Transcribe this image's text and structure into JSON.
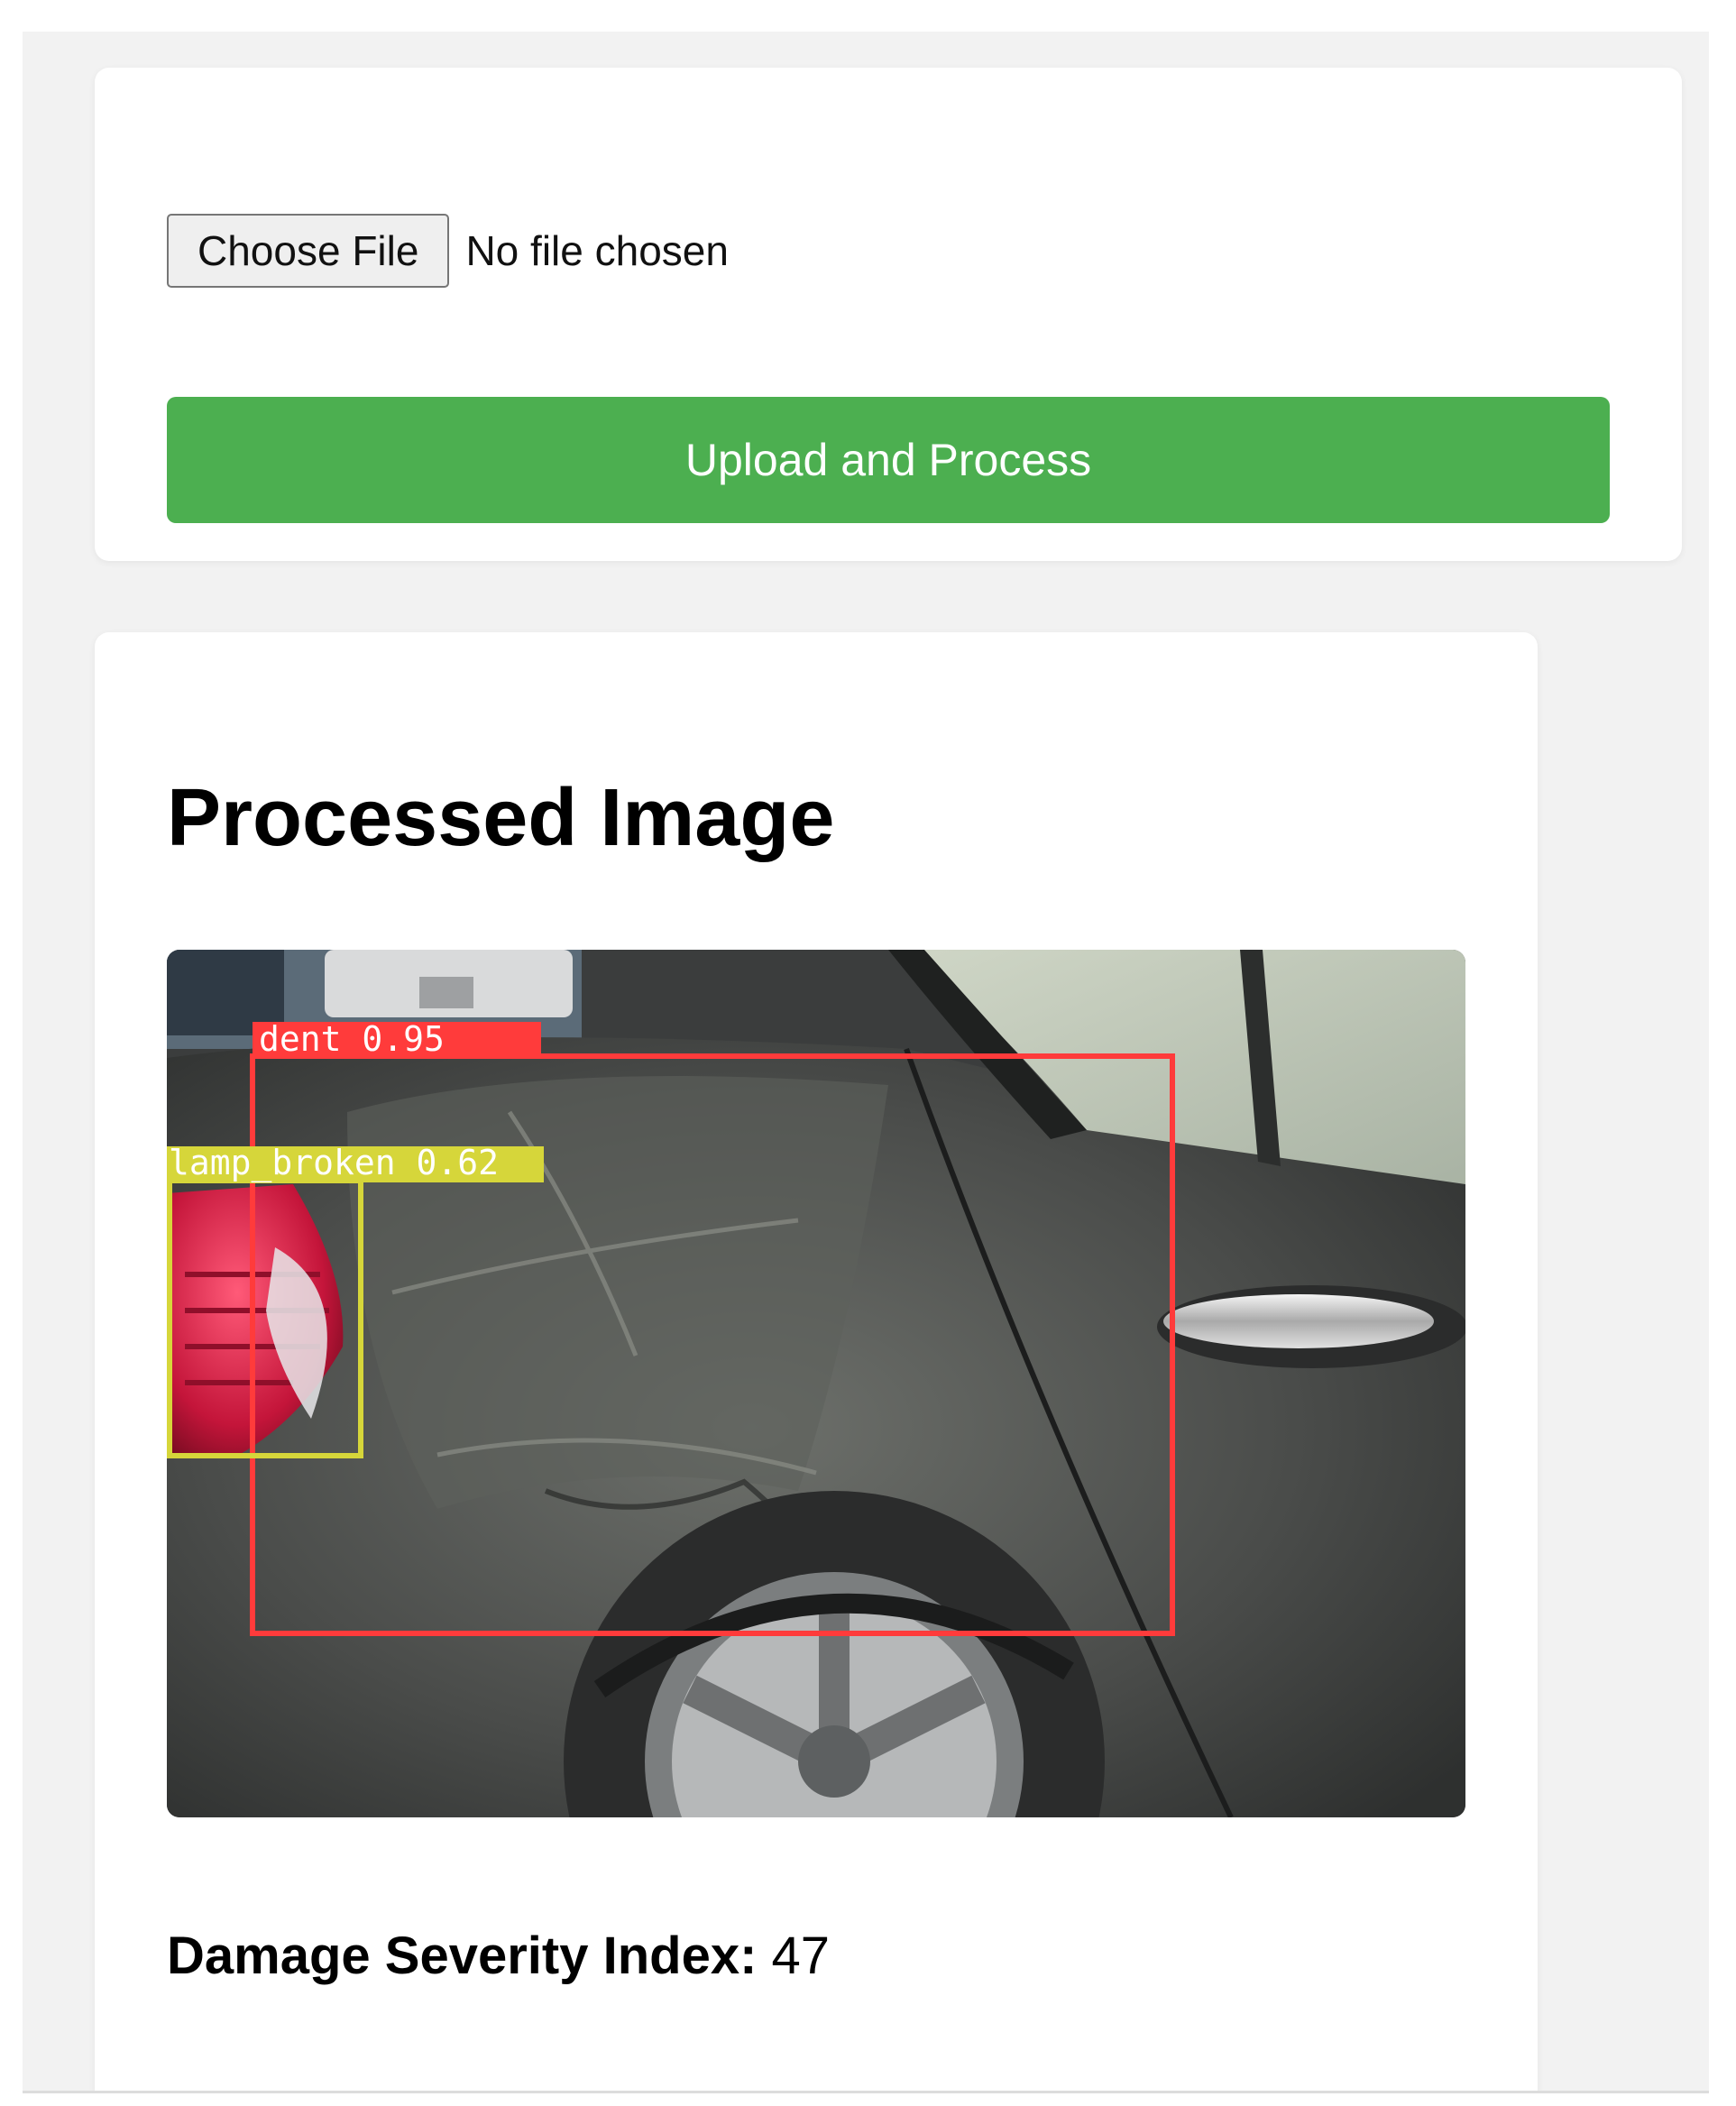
{
  "colors": {
    "upload_button_bg": "#4caf50",
    "dent_box": "#ff3b3b",
    "lamp_box": "#d6d63a"
  },
  "upload_form": {
    "choose_file_label": "Choose File",
    "file_status": "No file chosen",
    "upload_button_label": "Upload and Process"
  },
  "result": {
    "title": "Processed Image",
    "detections": [
      {
        "label": "dent 0.95",
        "icon": "bounding-box"
      },
      {
        "label": "lamp_broken 0.62",
        "icon": "bounding-box"
      }
    ],
    "severity_label": "Damage Severity Index:",
    "severity_value": "47"
  }
}
